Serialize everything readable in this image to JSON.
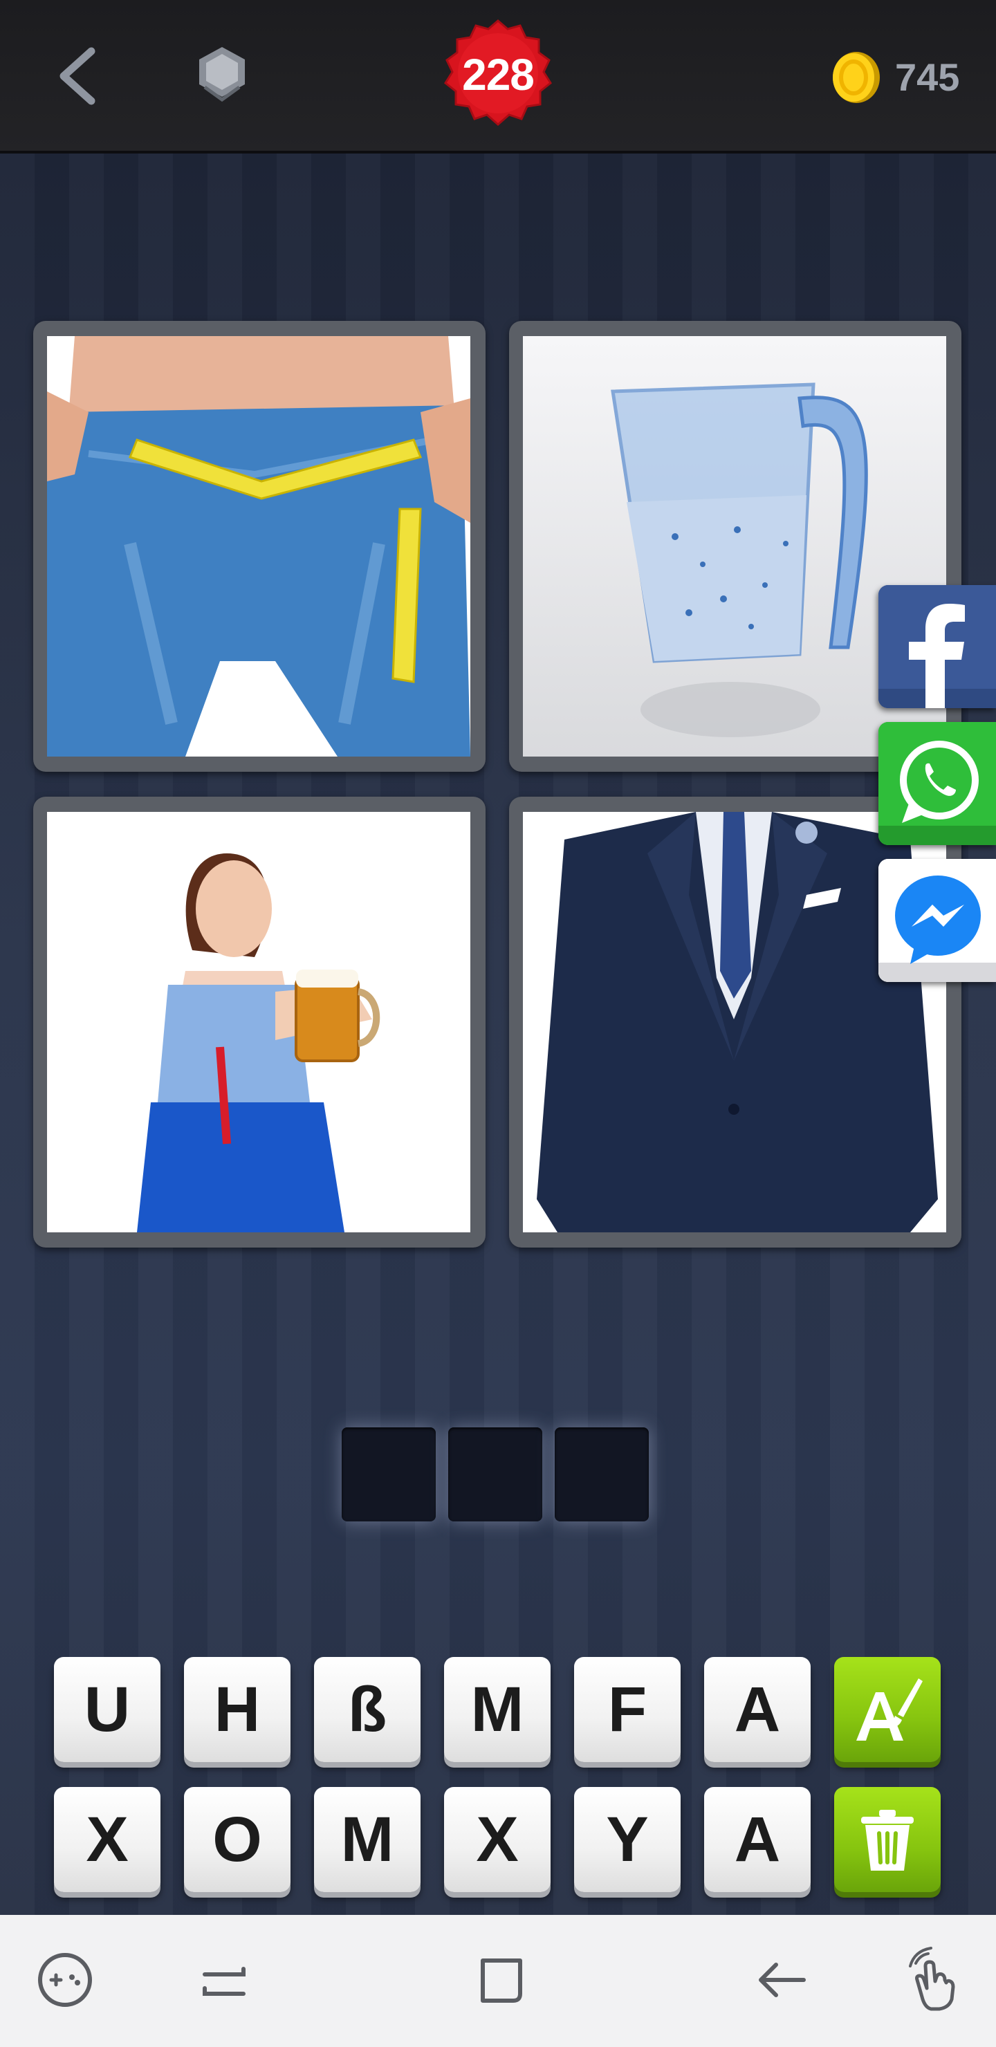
{
  "header": {
    "level": "228",
    "coins": "745",
    "icons": {
      "back": "chevron-left-icon",
      "hex": "hexagon-badge-icon",
      "coin": "coin-icon"
    }
  },
  "puzzle": {
    "pictures": [
      {
        "name": "jeans-measuring-tape"
      },
      {
        "name": "detergent-measuring-cup"
      },
      {
        "name": "woman-dirndl-beer"
      },
      {
        "name": "navy-suit-jacket"
      }
    ],
    "answer_slots": [
      "",
      "",
      ""
    ]
  },
  "share": [
    {
      "name": "facebook",
      "color": "#3b5998",
      "icon": "facebook-icon"
    },
    {
      "name": "whatsapp",
      "color": "#2fbe3a",
      "icon": "whatsapp-icon"
    },
    {
      "name": "messenger",
      "color": "#ffffff",
      "icon": "messenger-icon"
    }
  ],
  "keyboard": {
    "row1": [
      "U",
      "H",
      "ß",
      "M",
      "F",
      "A"
    ],
    "row2": [
      "X",
      "O",
      "M",
      "X",
      "Y",
      "A"
    ],
    "hint_reveal_icon": "reveal-letter-icon",
    "hint_remove_icon": "trash-icon",
    "accent": "#86c40f"
  },
  "navbar": {
    "icons": [
      "game-controller-icon",
      "recent-apps-icon",
      "home-icon",
      "back-arrow-icon",
      "gesture-hand-icon"
    ]
  }
}
